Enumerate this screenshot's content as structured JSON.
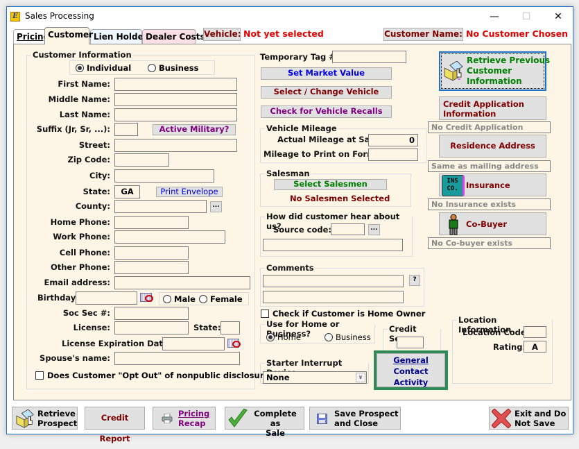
{
  "window": {
    "title": "Sales Processing",
    "app_icon": "ez-app-icon",
    "controls": {
      "minimize": "—",
      "maximize": "☐",
      "close": "✕"
    }
  },
  "tabs": [
    {
      "label": "Pricing",
      "active": false,
      "color": "#ffffff"
    },
    {
      "label": "Customer",
      "active": true,
      "color": "#fdf5e6"
    },
    {
      "label": "Lien Holder",
      "active": false,
      "color": "#eef6ff"
    },
    {
      "label": "Dealer Costs",
      "active": false,
      "color": "#fce0e8"
    }
  ],
  "header": {
    "vehicle_label": "Vehicle:",
    "vehicle_value": "Not yet selected",
    "customer_label": "Customer Name:",
    "customer_value": "No Customer Chosen"
  },
  "customer_info": {
    "group_title": "Customer Information",
    "type_options": {
      "individual": "Individual",
      "business": "Business",
      "selected": "Individual"
    },
    "fields": {
      "first_name": {
        "label": "First Name:",
        "value": ""
      },
      "middle_name": {
        "label": "Middle Name:",
        "value": ""
      },
      "last_name": {
        "label": "Last Name:",
        "value": ""
      },
      "suffix": {
        "label": "Suffix (Jr, Sr, ...):",
        "value": ""
      },
      "street": {
        "label": "Street:",
        "value": ""
      },
      "zip": {
        "label": "Zip Code:",
        "value": ""
      },
      "city": {
        "label": "City:",
        "value": ""
      },
      "state": {
        "label": "State:",
        "value": "GA"
      },
      "county": {
        "label": "County:",
        "value": ""
      },
      "home_phone": {
        "label": "Home Phone:",
        "value": ""
      },
      "work_phone": {
        "label": "Work Phone:",
        "value": ""
      },
      "cell_phone": {
        "label": "Cell Phone:",
        "value": ""
      },
      "other_phone": {
        "label": "Other Phone:",
        "value": ""
      },
      "email": {
        "label": "Email address:",
        "value": ""
      },
      "birthday": {
        "label": "Birthday:",
        "value": ""
      },
      "ssn": {
        "label": "Soc Sec #:",
        "value": ""
      },
      "license": {
        "label": "License:",
        "value": ""
      },
      "license_state": {
        "label": "State:",
        "value": ""
      },
      "license_exp": {
        "label": "License Expiration Date:",
        "value": ""
      },
      "spouse": {
        "label": "Spouse's name:",
        "value": ""
      }
    },
    "active_military_button": "Active Military?",
    "print_envelope_button": "Print Envelope",
    "ellipsis": "...",
    "gender": {
      "male": "Male",
      "female": "Female",
      "selected": ""
    },
    "opt_out_label": "Does Customer \"Opt Out\" of nonpublic disclosure?",
    "opt_out_checked": false
  },
  "vehicle": {
    "temp_tag_label": "Temporary Tag #:",
    "temp_tag_value": "",
    "set_market_value": "Set Market Value",
    "select_change_vehicle": "Select / Change Vehicle",
    "check_recalls": "Check for Vehicle Recalls",
    "mileage_group": "Vehicle Mileage",
    "actual_mileage_label": "Actual Mileage at Sale:",
    "actual_mileage_value": "0",
    "print_mileage_label": "Mileage to Print on Forms:",
    "print_mileage_value": ""
  },
  "salesman": {
    "group_title": "Salesman",
    "select_button": "Select Salesmen",
    "status": "No Salesmen Selected"
  },
  "source": {
    "group_title": "How did customer hear about us?",
    "source_code_label": "Source code:",
    "source_code_value": "",
    "description_value": "",
    "ellipsis": "..."
  },
  "comments": {
    "group_title": "Comments",
    "line1": "",
    "line2": "",
    "help_button": "?"
  },
  "home_owner": {
    "label": "Check if Customer is Home Owner",
    "checked": false
  },
  "use_for": {
    "group_title": "Use for Home or Business?",
    "home": "Home",
    "business": "Business",
    "selected": "Home"
  },
  "credit_score": {
    "group_title": "Credit Score",
    "value": ""
  },
  "starter_interrupt": {
    "group_title": "Starter Interrupt Device",
    "selected": "None"
  },
  "general_contact": {
    "line1": "General",
    "line2": "Contact",
    "line3": "Activity"
  },
  "location": {
    "group_title": "Location Information",
    "code_label": "Location Code:",
    "code_value": "",
    "rating_label": "Rating:",
    "rating_value": "A"
  },
  "right_panel": {
    "retrieve_previous": {
      "line1": "Retrieve Previous",
      "line2": "Customer",
      "line3": "Information"
    },
    "credit_app": {
      "line1": "Credit Application",
      "line2": "Information",
      "status": "No Credit Application"
    },
    "residence": {
      "label": "Residence Address",
      "status": "Same as mailing address"
    },
    "insurance": {
      "label": "Insurance",
      "status": "No Insurance exists",
      "icon_text1": "INS",
      "icon_text2": "CO."
    },
    "cobuyer": {
      "label": "Co-Buyer",
      "status": "No Co-buyer exists"
    }
  },
  "bottom_buttons": {
    "retrieve_prospect": {
      "line1": "Retrieve",
      "line2": "Prospect"
    },
    "credit_report": "Credit Report",
    "pricing_recap": {
      "line1": "Pricing",
      "line2": "Recap"
    },
    "complete_sale": {
      "line1": "Complete as",
      "line2": "Sale"
    },
    "save_prospect": {
      "line1": "Save Prospect",
      "line2": "and Close"
    },
    "exit_no_save": {
      "line1": "Exit and Do",
      "line2": "Not Save"
    }
  },
  "colors": {
    "panel_bg": "#fdf5e6",
    "accent_red": "#e00000",
    "dark_red": "#800000",
    "focus_green": "#2e8b57",
    "window_border": "#1e73c9"
  }
}
